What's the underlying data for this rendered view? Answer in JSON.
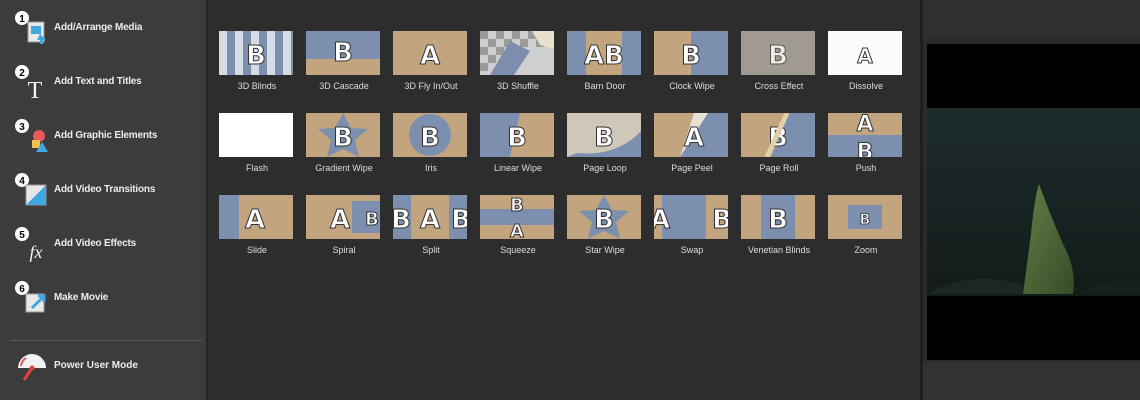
{
  "sidebar": {
    "steps": [
      {
        "number": "1",
        "label": "Add/Arrange Media",
        "icon": "add-media-icon"
      },
      {
        "number": "2",
        "label": "Add Text and Titles",
        "icon": "text-titles-icon"
      },
      {
        "number": "3",
        "label": "Add Graphic Elements",
        "icon": "graphic-elements-icon"
      },
      {
        "number": "4",
        "label": "Add Video Transitions",
        "icon": "video-transitions-icon"
      },
      {
        "number": "5",
        "label": "Add Video Effects",
        "icon": "video-effects-icon"
      },
      {
        "number": "6",
        "label": "Make Movie",
        "icon": "make-movie-icon"
      }
    ],
    "power_user": {
      "label": "Power User Mode",
      "icon": "gauge-icon"
    }
  },
  "transitions": [
    {
      "label": "3D Blinds"
    },
    {
      "label": "3D Cascade"
    },
    {
      "label": "3D Fly In/Out"
    },
    {
      "label": "3D Shuffle"
    },
    {
      "label": "Barn Door"
    },
    {
      "label": "Clock Wipe"
    },
    {
      "label": "Cross Effect"
    },
    {
      "label": "Dissolve"
    },
    {
      "label": "Flash"
    },
    {
      "label": "Gradient Wipe"
    },
    {
      "label": "Iris"
    },
    {
      "label": "Linear Wipe"
    },
    {
      "label": "Page Loop"
    },
    {
      "label": "Page Peel"
    },
    {
      "label": "Page Roll"
    },
    {
      "label": "Push"
    },
    {
      "label": "Slide"
    },
    {
      "label": "Spiral"
    },
    {
      "label": "Split"
    },
    {
      "label": "Squeeze"
    },
    {
      "label": "Star Wipe"
    },
    {
      "label": "Swap"
    },
    {
      "label": "Venetian Blinds"
    },
    {
      "label": "Zoom"
    }
  ],
  "thumb_letters": {
    "a": "A",
    "b": "B"
  },
  "colors": {
    "tan": "#c2a57e",
    "blue": "#7c8fae",
    "sidebar_bg": "#3c3c3c",
    "grid_bg": "#2d2d2d",
    "text": "#ececec"
  }
}
